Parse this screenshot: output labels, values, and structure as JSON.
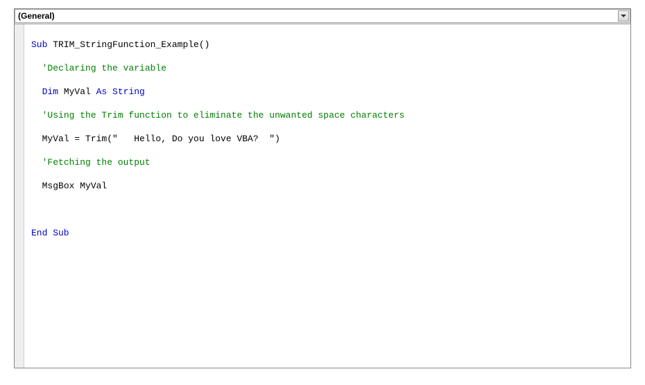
{
  "dropdown": {
    "object": "(General)"
  },
  "code": {
    "line1": {
      "sub": "Sub",
      "name": " TRIM_StringFunction_Example()"
    },
    "line2": "'Declaring the variable",
    "line3": {
      "dim": "Dim",
      "var": " MyVal ",
      "as": "As",
      "type": " String"
    },
    "line4": "'Using the Trim function to eliminate the unwanted space characters",
    "line5": "MyVal = Trim(\"   Hello, Do you love VBA?  \")",
    "line6": "'Fetching the output",
    "line7": "MsgBox MyVal",
    "line8": "",
    "line9": "End Sub"
  }
}
